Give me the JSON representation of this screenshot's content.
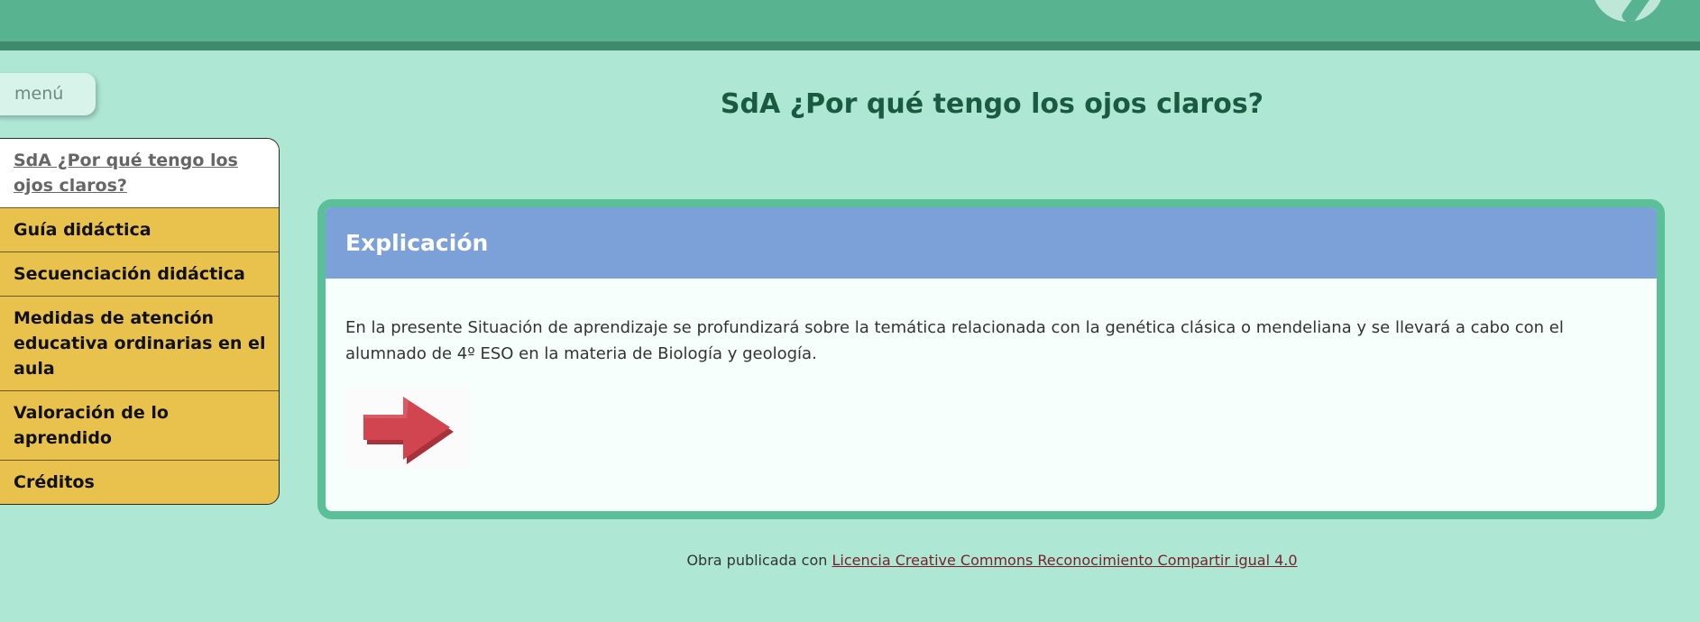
{
  "header": {
    "logo_icon": "leaf-logo-icon"
  },
  "menu": {
    "toggle_label": "menú"
  },
  "sidebar": {
    "items": [
      {
        "label": "SdA ¿Por qué tengo los ojos claros?",
        "active": true
      },
      {
        "label": "Guía didáctica",
        "active": false
      },
      {
        "label": "Secuenciación didáctica",
        "active": false
      },
      {
        "label": "Medidas de atención educativa ordinarias en el aula",
        "active": false
      },
      {
        "label": "Valoración de lo aprendido",
        "active": false
      },
      {
        "label": "Créditos",
        "active": false
      }
    ]
  },
  "main": {
    "title": "SdA ¿Por qué tengo los ojos claros?",
    "card": {
      "header": "Explicación",
      "text": "En la presente Situación de aprendizaje se profundizará sobre la temática relacionada con la genética clásica o mendeliana y se llevará a cabo con el alumnado de 4º ESO en la materia de Biología y geología.",
      "image_icon": "red-arrow-icon"
    }
  },
  "footer": {
    "prefix": "Obra publicada con",
    "link_text": "Licencia Creative Commons Reconocimiento Compartir igual 4.0"
  },
  "colors": {
    "background": "#aee8d5",
    "topbar": "#58b391",
    "sidebar_item": "#e9c24e",
    "card_border": "#5bbf9a",
    "card_header": "#7ca0d8",
    "title": "#1b5a42",
    "arrow": "#d0454f"
  }
}
